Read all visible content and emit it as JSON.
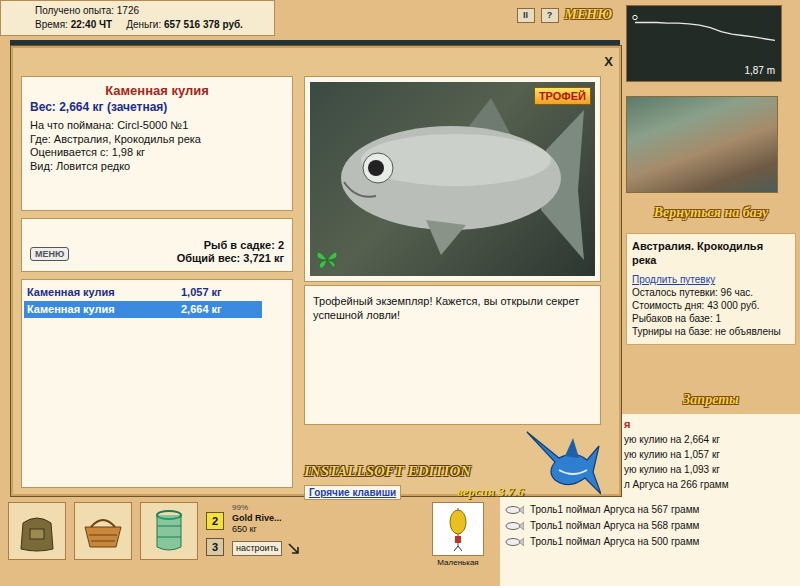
{
  "status": {
    "experience_label": "Получено опыта:",
    "experience": "1726",
    "time_label": "Время:",
    "time": "22:40 ЧТ",
    "money_label": "Деньги:",
    "money": "657 516 378 руб."
  },
  "top_buttons": {
    "pause": "II",
    "help": "?",
    "menu": "МЕНЮ"
  },
  "depth": {
    "reading": "1,87 m",
    "profile": [
      0.5,
      0.5,
      0.5,
      0.55,
      0.55,
      0.6,
      0.7,
      0.9,
      1.2,
      1.4,
      1.5,
      1.6,
      1.75,
      1.87
    ]
  },
  "return_button": "Вернуться на базу",
  "location": {
    "title": "Австралия. Крокодилья река",
    "extend_link": "Продлить путевку",
    "details": [
      "Осталось путевки: 96 час.",
      "Стоимость дня: 43 000 руб.",
      "Рыбаков на базе: 1",
      "Турниры на базе: не объявлены"
    ]
  },
  "bans_button": "Запреты",
  "log": {
    "header": "я",
    "rows": [
      {
        "text": "ую кулию на 2,664 кг",
        "kind": "partial"
      },
      {
        "text": "ую кулию на 1,057 кг",
        "kind": "partial"
      },
      {
        "text": "ую кулию на 1,093 кг",
        "kind": "partial"
      },
      {
        "text": "л Аргуса на 266 грамм",
        "kind": "partial"
      },
      {
        "text": "Троль1 поймал Аргуса на 567 грамм",
        "kind": "full"
      },
      {
        "text": "Троль1 поймал Аргуса на 568 грамм",
        "kind": "full"
      },
      {
        "text": "Троль1 поймал Аргуса на 500 грамм",
        "kind": "full"
      }
    ]
  },
  "toolbar": {
    "slots": [
      {
        "label": "2",
        "selected": true
      },
      {
        "label": "3",
        "selected": false
      }
    ],
    "rod": {
      "condition": "99%",
      "reel": "Gold Rive...",
      "line": "650 кг",
      "setup_button": "настроить"
    },
    "lure": {
      "label": "Маленькая"
    }
  },
  "modal": {
    "close": "X",
    "fish": {
      "name": "Каменная кулия",
      "weight": "Вес: 2,664 кг (зачетная)",
      "details": [
        "На что поймана: Circl-5000 №1",
        "Где: Австралия, Крокодилья река",
        "Оценивается с: 1,98 кг",
        "Вид: Ловится редко"
      ]
    },
    "menu_button": "МЕНЮ",
    "keepnet": [
      "Рыб в садке: 2",
      "Общий вес: 3,721 кг"
    ],
    "catches": [
      {
        "name": "Каменная кулия",
        "weight": "1,057 кг",
        "selected": false
      },
      {
        "name": "Каменная кулия",
        "weight": "2,664 кг",
        "selected": true
      }
    ],
    "photo": {
      "badge": "ТРОФЕЙ"
    },
    "message": "Трофейный экземпляр! Кажется, вы открыли секрет успешной ловли!",
    "hotkeys_button": "Горячие клавиши",
    "logo": {
      "title": "INSTALLSOFT EDITION",
      "version": "версия 3.7.6"
    }
  }
}
